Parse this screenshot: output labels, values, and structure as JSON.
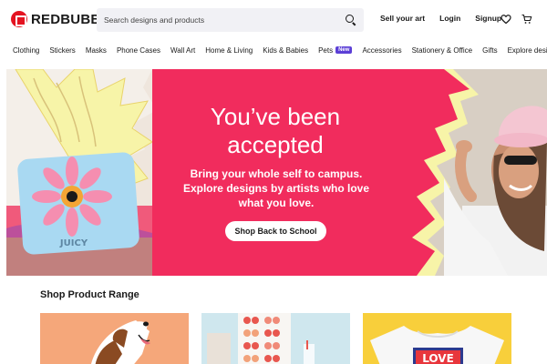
{
  "header": {
    "logo_text": "REDBUBBLE",
    "search_placeholder": "Search designs and products",
    "links": {
      "sell": "Sell your art",
      "login": "Login",
      "signup": "Signup"
    }
  },
  "categories": [
    {
      "label": "Clothing"
    },
    {
      "label": "Stickers"
    },
    {
      "label": "Masks"
    },
    {
      "label": "Phone Cases"
    },
    {
      "label": "Wall Art"
    },
    {
      "label": "Home & Living"
    },
    {
      "label": "Kids & Babies"
    },
    {
      "label": "Pets",
      "badge": "New"
    },
    {
      "label": "Accessories"
    },
    {
      "label": "Stationery & Office"
    },
    {
      "label": "Gifts"
    },
    {
      "label": "Explore designs"
    }
  ],
  "hero": {
    "title": "You’ve been accepted",
    "subtitle": "Bring your whole self to campus. Explore designs by artists who love what you love.",
    "cta": "Shop Back to School",
    "pillow_text": "JUICY",
    "colors": {
      "background": "#f12c5d",
      "starburst": "#f7f4a8"
    }
  },
  "shop_range": {
    "title": "Shop Product Range",
    "card3_text": "LOVE"
  }
}
